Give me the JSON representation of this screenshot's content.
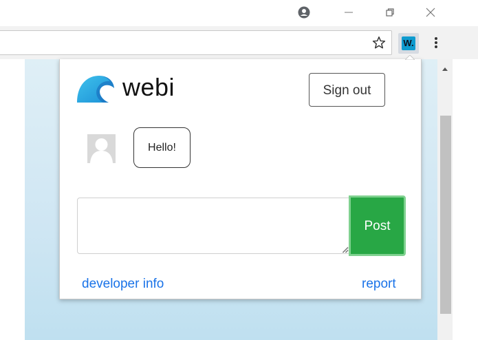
{
  "browser": {
    "window_controls": {
      "account_icon": "account-circle-icon",
      "minimize_icon": "minimize-icon",
      "restore_icon": "restore-icon",
      "close_icon": "close-icon"
    },
    "toolbar": {
      "bookmark_icon": "star-outline-icon",
      "extension_badge": "W.",
      "menu_icon": "vertical-dots-icon"
    }
  },
  "popup": {
    "brand": {
      "name": "webi",
      "logo_icon": "wave-icon",
      "logo_color": "#29a8e0"
    },
    "sign_out_label": "Sign out",
    "messages": [
      {
        "avatar_icon": "default-avatar-icon",
        "text": "Hello!"
      }
    ],
    "composer": {
      "value": "",
      "post_label": "Post",
      "post_color": "#28a745"
    },
    "footer": {
      "developer_link": "developer info",
      "report_link": "report",
      "link_color": "#1a73e8"
    }
  }
}
